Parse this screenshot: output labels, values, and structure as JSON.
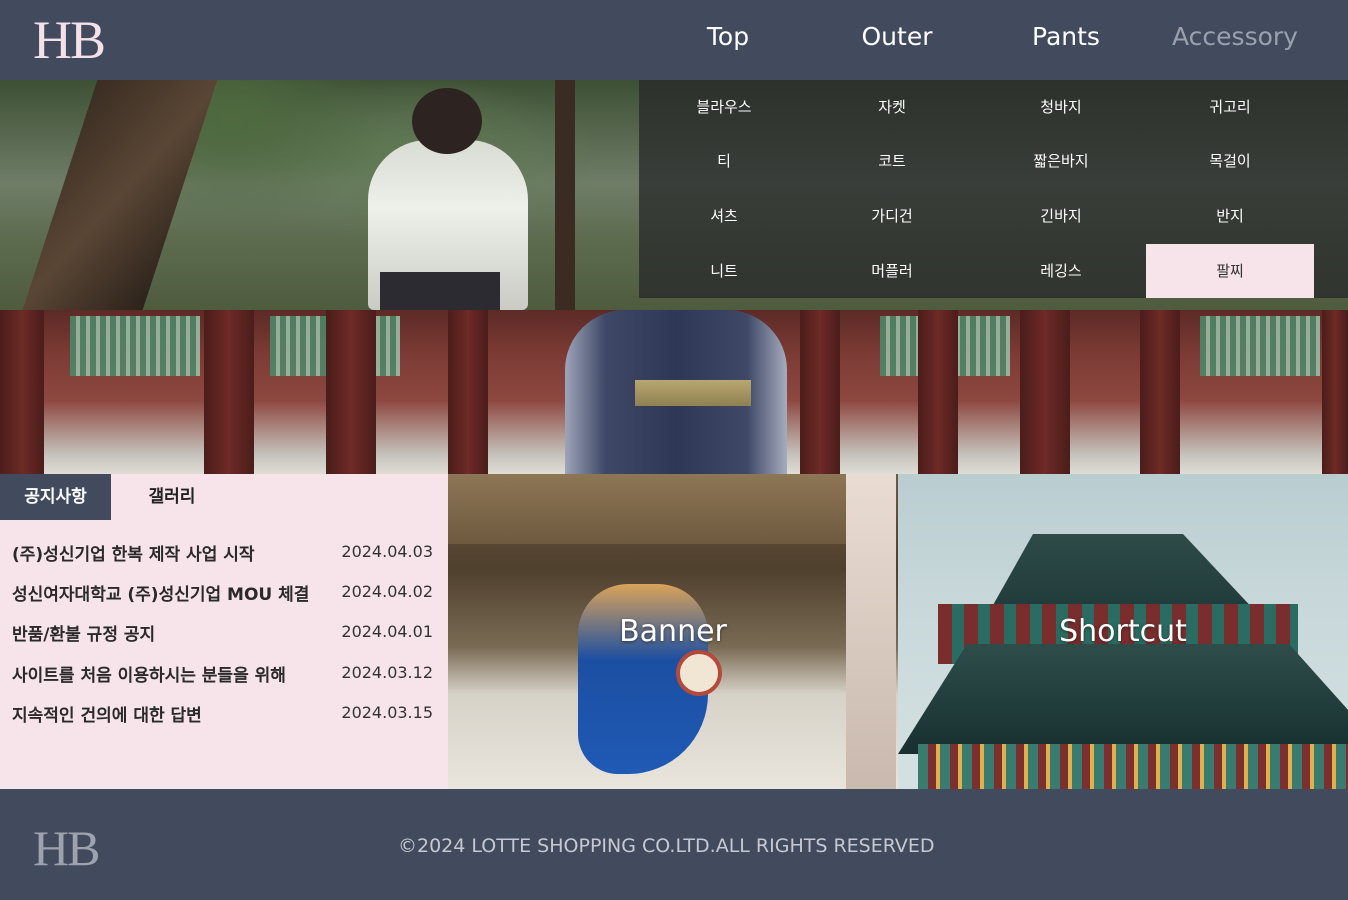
{
  "header": {
    "logo": "HB",
    "nav": [
      {
        "label": "Top"
      },
      {
        "label": "Outer"
      },
      {
        "label": "Pants"
      },
      {
        "label": "Accessory"
      }
    ]
  },
  "dropdown": {
    "columns": [
      [
        "블라우스",
        "티",
        "셔츠",
        "니트"
      ],
      [
        "자켓",
        "코트",
        "가디건",
        "머플러"
      ],
      [
        "청바지",
        "짧은바지",
        "긴바지",
        "레깅스"
      ],
      [
        "귀고리",
        "목걸이",
        "반지",
        "팔찌"
      ]
    ],
    "active_item": "팔찌"
  },
  "notice": {
    "tabs": [
      {
        "label": "공지사항",
        "active": true
      },
      {
        "label": "갤러리",
        "active": false
      }
    ],
    "rows": [
      {
        "title": "(주)성신기업 한복 제작 사업 시작",
        "date": "2024.04.03"
      },
      {
        "title": "성신여자대학교 (주)성신기업 MOU 체결",
        "date": "2024.04.02"
      },
      {
        "title": "반품/환불 규정 공지",
        "date": "2024.04.01"
      },
      {
        "title": "사이트를 처음 이용하시는 분들을 위해",
        "date": "2024.03.12"
      },
      {
        "title": "지속적인 건의에 대한 답변",
        "date": "2024.03.15"
      }
    ]
  },
  "banner": {
    "label": "Banner"
  },
  "shortcut": {
    "label": "Shortcut"
  },
  "footer": {
    "logo": "HB",
    "copyright": "©2024 LOTTE SHOPPING CO.LTD.ALL RIGHTS RESERVED"
  },
  "colors": {
    "navy": "#424a5e",
    "pink": "#f6e4ea",
    "logo_pink": "#f4e1e8"
  }
}
